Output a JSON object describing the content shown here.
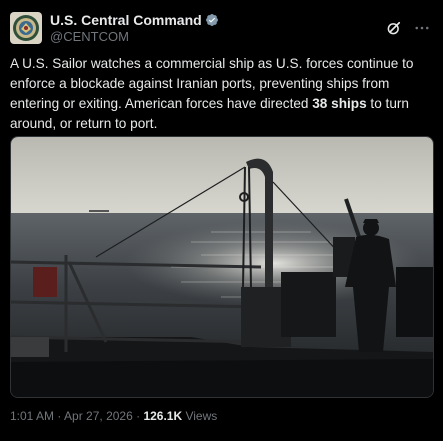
{
  "author": {
    "display_name": "U.S. Central Command",
    "handle": "@CENTCOM",
    "verified": true,
    "avatar": "centcom-seal"
  },
  "actions": {
    "grok_icon": "grok-icon",
    "more_icon": "more-icon"
  },
  "tweet": {
    "text_before": "A U.S. Sailor watches a commercial ship as U.S. forces continue to enforce a blockade against Iranian ports, preventing ships from entering or exiting. American forces have directed ",
    "text_bold": "38 ships",
    "text_after": " to turn around, or return to port."
  },
  "media": {
    "type": "photo"
  },
  "footer": {
    "time": "1:01 AM",
    "separator": " · ",
    "date": "Apr 27, 2026",
    "separator2": " · ",
    "views_count": "126.1K",
    "views_label": " Views"
  },
  "colors": {
    "background": "#000000",
    "text": "#e7e9ea",
    "secondary": "#71767b",
    "verified": "#829aab"
  }
}
